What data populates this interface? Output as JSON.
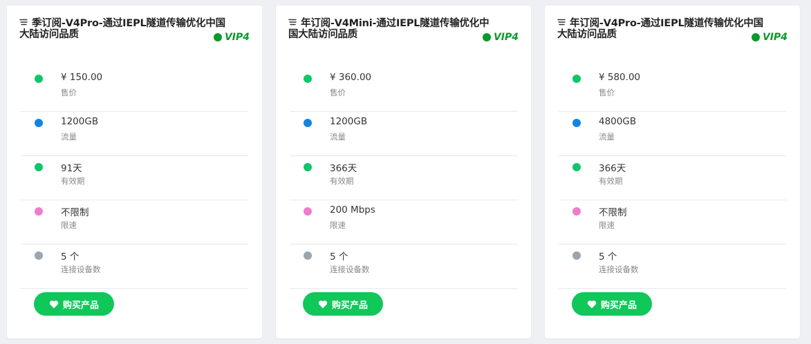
{
  "colors": {
    "price": "#10c66a",
    "traffic": "#1283e2",
    "validity": "#10c66a",
    "speed": "#f07ccd",
    "devices": "#9aa5ae",
    "vip": "#0a9a2a",
    "button": "#10c75a"
  },
  "cards": [
    {
      "title": "季订阅-V4Pro-通过IEPL隧道传输优化中国大陆访问品质",
      "vip": "VIP4",
      "rows": [
        {
          "value": "¥ 150.00",
          "label": "售价",
          "color_key": "price"
        },
        {
          "value": "1200GB",
          "label": "流量",
          "color_key": "traffic"
        },
        {
          "value": "91天",
          "label": "有效期",
          "color_key": "validity"
        },
        {
          "value": "不限制",
          "label": "限速",
          "color_key": "speed"
        },
        {
          "value": "5 个",
          "label": "连接设备数",
          "color_key": "devices"
        }
      ],
      "button": "购买产品"
    },
    {
      "title": "年订阅-V4Mini-通过IEPL隧道传输优化中国大陆访问品质",
      "vip": "VIP4",
      "rows": [
        {
          "value": "¥ 360.00",
          "label": "售价",
          "color_key": "price"
        },
        {
          "value": "1200GB",
          "label": "流量",
          "color_key": "traffic"
        },
        {
          "value": "366天",
          "label": "有效期",
          "color_key": "validity"
        },
        {
          "value": "200 Mbps",
          "label": "限速",
          "color_key": "speed"
        },
        {
          "value": "5 个",
          "label": "连接设备数",
          "color_key": "devices"
        }
      ],
      "button": "购买产品"
    },
    {
      "title": "年订阅-V4Pro-通过IEPL隧道传输优化中国大陆访问品质",
      "vip": "VIP4",
      "rows": [
        {
          "value": "¥ 580.00",
          "label": "售价",
          "color_key": "price"
        },
        {
          "value": "4800GB",
          "label": "流量",
          "color_key": "traffic"
        },
        {
          "value": "366天",
          "label": "有效期",
          "color_key": "validity"
        },
        {
          "value": "不限制",
          "label": "限速",
          "color_key": "speed"
        },
        {
          "value": "5 个",
          "label": "连接设备数",
          "color_key": "devices"
        }
      ],
      "button": "购买产品"
    }
  ]
}
